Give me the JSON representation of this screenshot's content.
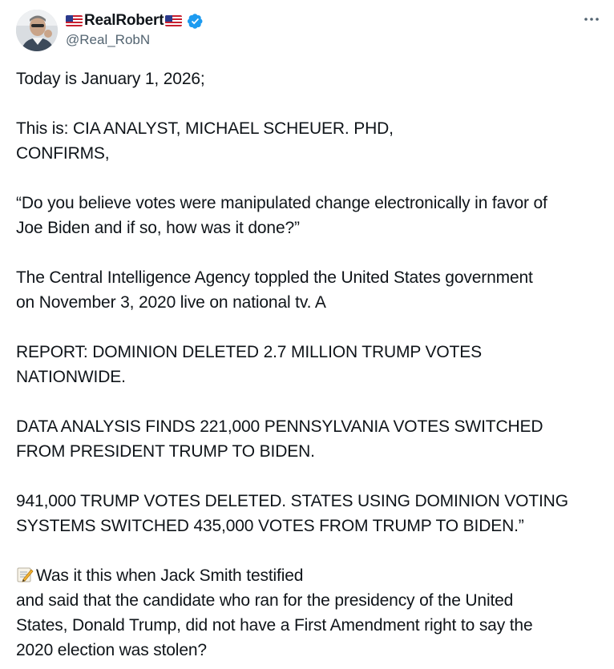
{
  "author": {
    "display_name": "RealRobert",
    "handle": "@Real_RobN",
    "flag_icon": "us-flag-icon",
    "verified_color": "#1d9bf0"
  },
  "more_icon": "more-horizontal-icon",
  "post": {
    "p1": [
      "Today is January 1, 2026;"
    ],
    "p2": [
      "This is: CIA ANALYST, MICHAEL SCHEUER. PHD,",
      "CONFIRMS,"
    ],
    "p3": [
      "“Do you believe votes were manipulated change electronically in favor of",
      "Joe Biden and if so, how was it done?”"
    ],
    "p4": [
      "The Central Intelligence Agency toppled the United States government",
      "on November 3, 2020 live on national tv. A"
    ],
    "p5": [
      "REPORT: DOMINION DELETED 2.7 MILLION TRUMP VOTES",
      "NATIONWIDE."
    ],
    "p6": [
      "DATA ANALYSIS FINDS 221,000 PENNSYLVANIA VOTES SWITCHED",
      "FROM PRESIDENT TRUMP TO BIDEN."
    ],
    "p7": [
      "941,000 TRUMP VOTES DELETED. STATES USING DOMINION VOTING",
      "SYSTEMS SWITCHED 435,000 VOTES FROM TRUMP TO BIDEN.”"
    ],
    "p8_icon": "memo-icon",
    "p8": [
      "Was it this when Jack Smith testified",
      "and said that the candidate who ran for the presidency of the United",
      "States, Donald Trump, did not have a First Amendment right to say the",
      "2020 election was stolen?"
    ]
  }
}
